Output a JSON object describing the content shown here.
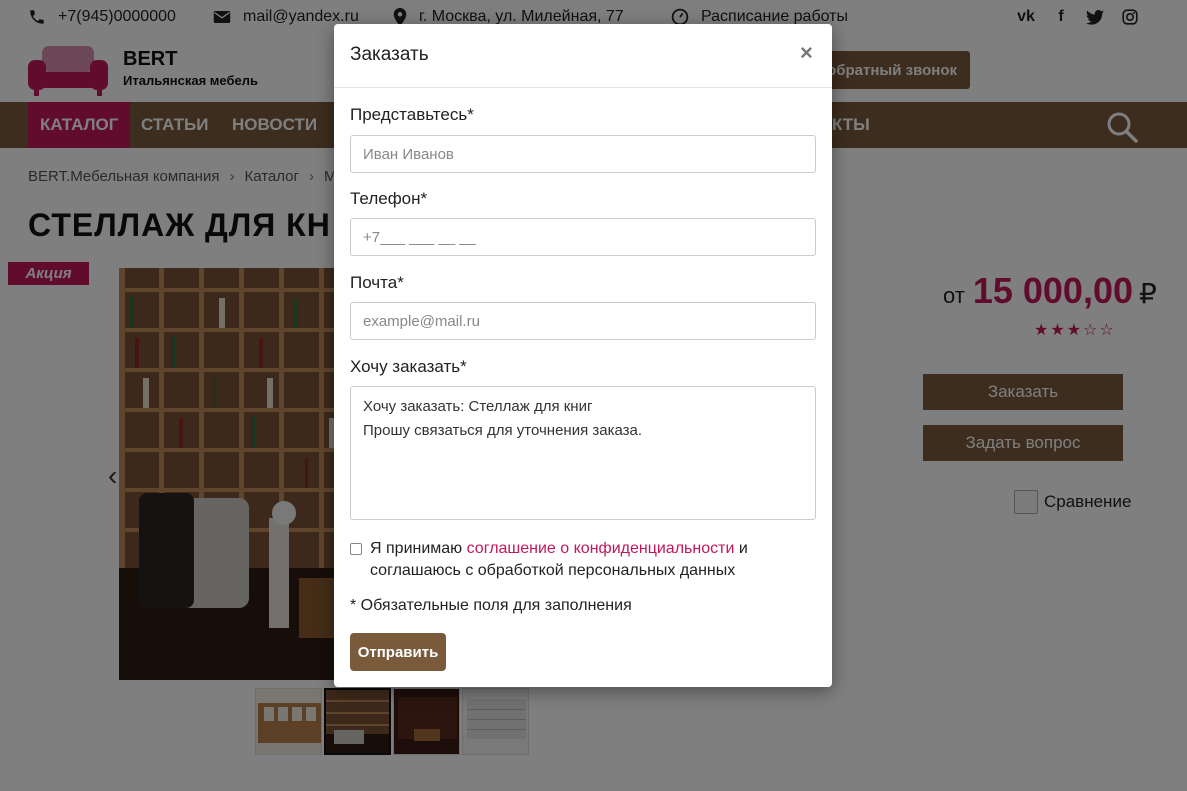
{
  "topbar": {
    "phone": "+7(945)0000000",
    "email": "mail@yandex.ru",
    "address": "г. Москва, ул. Милейная, 77",
    "schedule": "Расписание работы",
    "socials": [
      "vk-icon",
      "facebook-icon",
      "twitter-icon",
      "instagram-icon"
    ]
  },
  "header": {
    "logo_title": "BERT",
    "logo_subtitle": "Итальянская мебель",
    "callback_label": "ь обратный звонок"
  },
  "nav": {
    "items": [
      "КАТАЛОГ",
      "СТАТЬИ",
      "НОВОСТИ",
      "КТЫ"
    ],
    "active_index": 0
  },
  "breadcrumb": [
    "BERT.Мебельная компания",
    "Каталог",
    "М"
  ],
  "product": {
    "title": "СТЕЛЛАЖ ДЛЯ КН",
    "badge": "Акция",
    "price_prefix": "от",
    "price": "15 000,00",
    "currency": "₽",
    "rating": 3,
    "rating_max": 5,
    "order_button": "Заказать",
    "question_button": "Задать вопрос",
    "compare_label": "Сравнение"
  },
  "modal": {
    "title": "Заказать",
    "close": "×",
    "name_label": "Представьтесь*",
    "name_placeholder": "Иван Иванов",
    "phone_label": "Телефон*",
    "phone_placeholder": "+7___ ___ __ __",
    "email_label": "Почта*",
    "email_placeholder": "example@mail.ru",
    "order_label": "Хочу заказать*",
    "order_line1": "Хочу заказать: Стеллаж для книг",
    "order_line2": "Прошу связаться для уточнения заказа.",
    "agree_prefix": "Я принимаю ",
    "agree_link": "соглашение о конфиденциальности",
    "agree_suffix": " и соглашаюсь с обработкой персональных данных",
    "required_note": "* Обязательные поля для заполнения",
    "submit": "Отправить"
  },
  "colors": {
    "brand_brown": "#795b3c",
    "accent_pink": "#c2185b"
  }
}
